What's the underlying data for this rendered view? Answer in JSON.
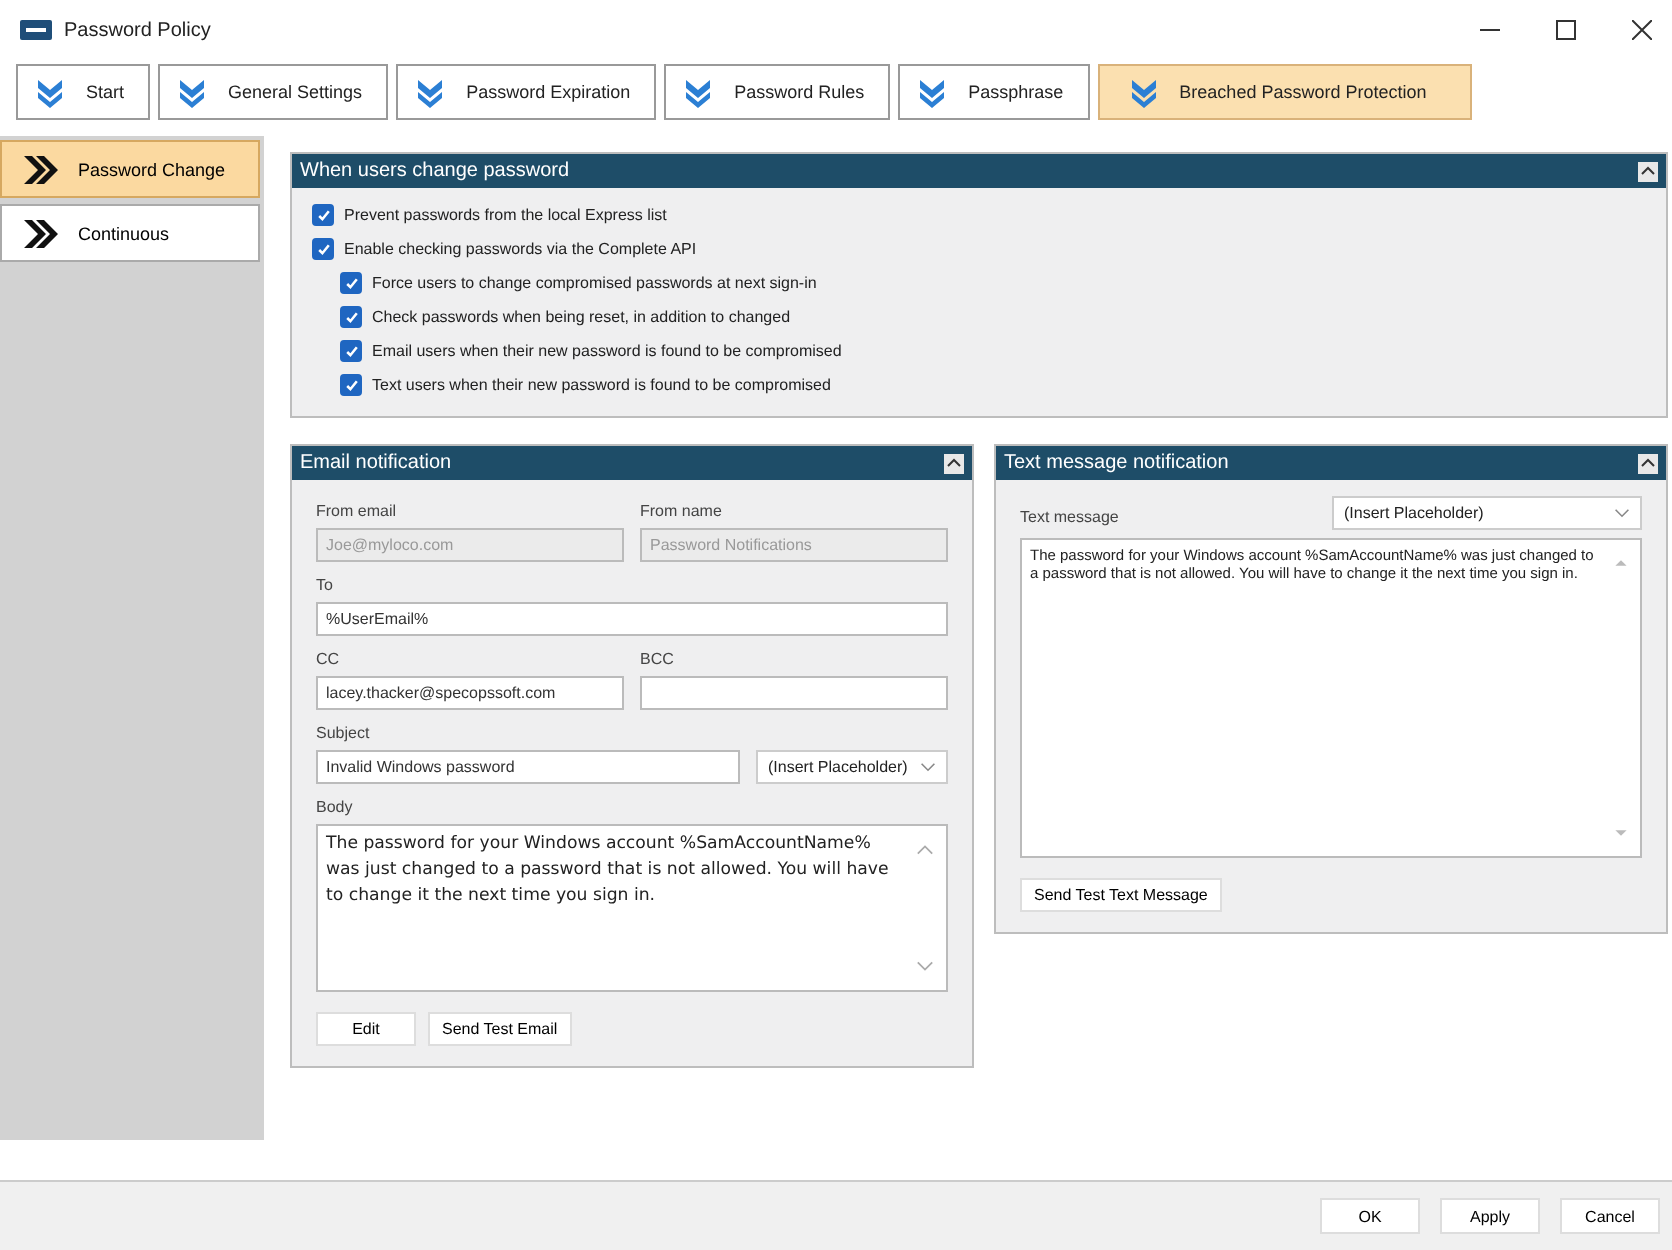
{
  "window": {
    "title": "Password Policy"
  },
  "tabs": [
    {
      "label": "Start",
      "selected": false
    },
    {
      "label": "General Settings",
      "selected": false
    },
    {
      "label": "Password Expiration",
      "selected": false
    },
    {
      "label": "Password Rules",
      "selected": false
    },
    {
      "label": "Passphrase",
      "selected": false
    },
    {
      "label": "Breached Password Protection",
      "selected": true
    }
  ],
  "sidebar": {
    "items": [
      {
        "label": "Password Change",
        "selected": true
      },
      {
        "label": "Continuous",
        "selected": false
      }
    ]
  },
  "change_section": {
    "title": "When users change password",
    "options": [
      {
        "label": "Prevent passwords from the local Express list",
        "checked": true
      },
      {
        "label": "Enable checking passwords via the Complete API",
        "checked": true,
        "children": [
          {
            "label": "Force users to change compromised passwords at next sign-in",
            "checked": true
          },
          {
            "label": "Check passwords when being reset, in addition to changed",
            "checked": true
          },
          {
            "label": "Email users when their new password is found to be compromised",
            "checked": true
          },
          {
            "label": "Text users when their new password is found to be compromised",
            "checked": true
          }
        ]
      }
    ]
  },
  "email": {
    "title": "Email notification",
    "from_email": {
      "label": "From email",
      "value": "Joe@myloco.com",
      "disabled": true
    },
    "from_name": {
      "label": "From name",
      "value": "Password Notifications",
      "disabled": true
    },
    "to": {
      "label": "To",
      "value": "%UserEmail%"
    },
    "cc": {
      "label": "CC",
      "value": "lacey.thacker@specopssoft.com"
    },
    "bcc": {
      "label": "BCC"
    },
    "subject": {
      "label": "Subject",
      "value": "Invalid Windows password",
      "placeholder_menu": "(Insert Placeholder)"
    },
    "body": {
      "label": "Body",
      "value": "The password for your Windows account %SamAccountName% was just changed to a password that is not allowed. You will have to change it the next time you sign in."
    },
    "buttons": [
      "Edit",
      "Send Test Email"
    ]
  },
  "text_message": {
    "title": "Text message notification",
    "label": "Text message",
    "placeholder_menu": "(Insert Placeholder)",
    "value": "The password for your Windows account %SamAccountName% was just changed to a password that is not allowed. You will have to change it the next time you sign in.",
    "button": "Send Test Text Message"
  },
  "footer_buttons": [
    "OK",
    "Apply",
    "Cancel"
  ]
}
